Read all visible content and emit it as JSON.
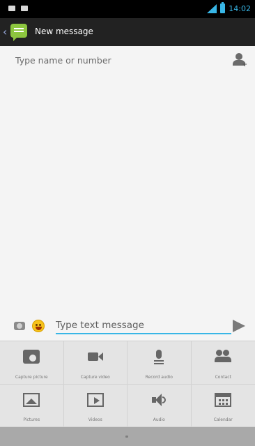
{
  "status_bar": {
    "time": "14:02",
    "icons": [
      "notification-icon",
      "gallery-icon",
      "signal-icon",
      "battery-icon"
    ],
    "accent_color": "#38b6e6"
  },
  "action_bar": {
    "title": "New message",
    "back_icon": "chevron-left-icon",
    "app_icon": "messaging-app-icon"
  },
  "recipient": {
    "placeholder": "Type name or number",
    "value": "",
    "picker_icon": "add-contact-icon"
  },
  "composer": {
    "placeholder": "Type text message",
    "value": "",
    "attach_icon": "attachment-icon",
    "emoji_icon": "smiley-icon",
    "send_icon": "send-icon"
  },
  "attachments": [
    {
      "label": "Capture picture",
      "icon": "camera-icon"
    },
    {
      "label": "Capture video",
      "icon": "video-camera-icon"
    },
    {
      "label": "Record audio",
      "icon": "microphone-icon"
    },
    {
      "label": "Contact",
      "icon": "contact-icon"
    },
    {
      "label": "Pictures",
      "icon": "picture-icon"
    },
    {
      "label": "Videos",
      "icon": "video-file-icon"
    },
    {
      "label": "Audio",
      "icon": "audio-icon"
    },
    {
      "label": "Calendar",
      "icon": "calendar-icon"
    }
  ]
}
